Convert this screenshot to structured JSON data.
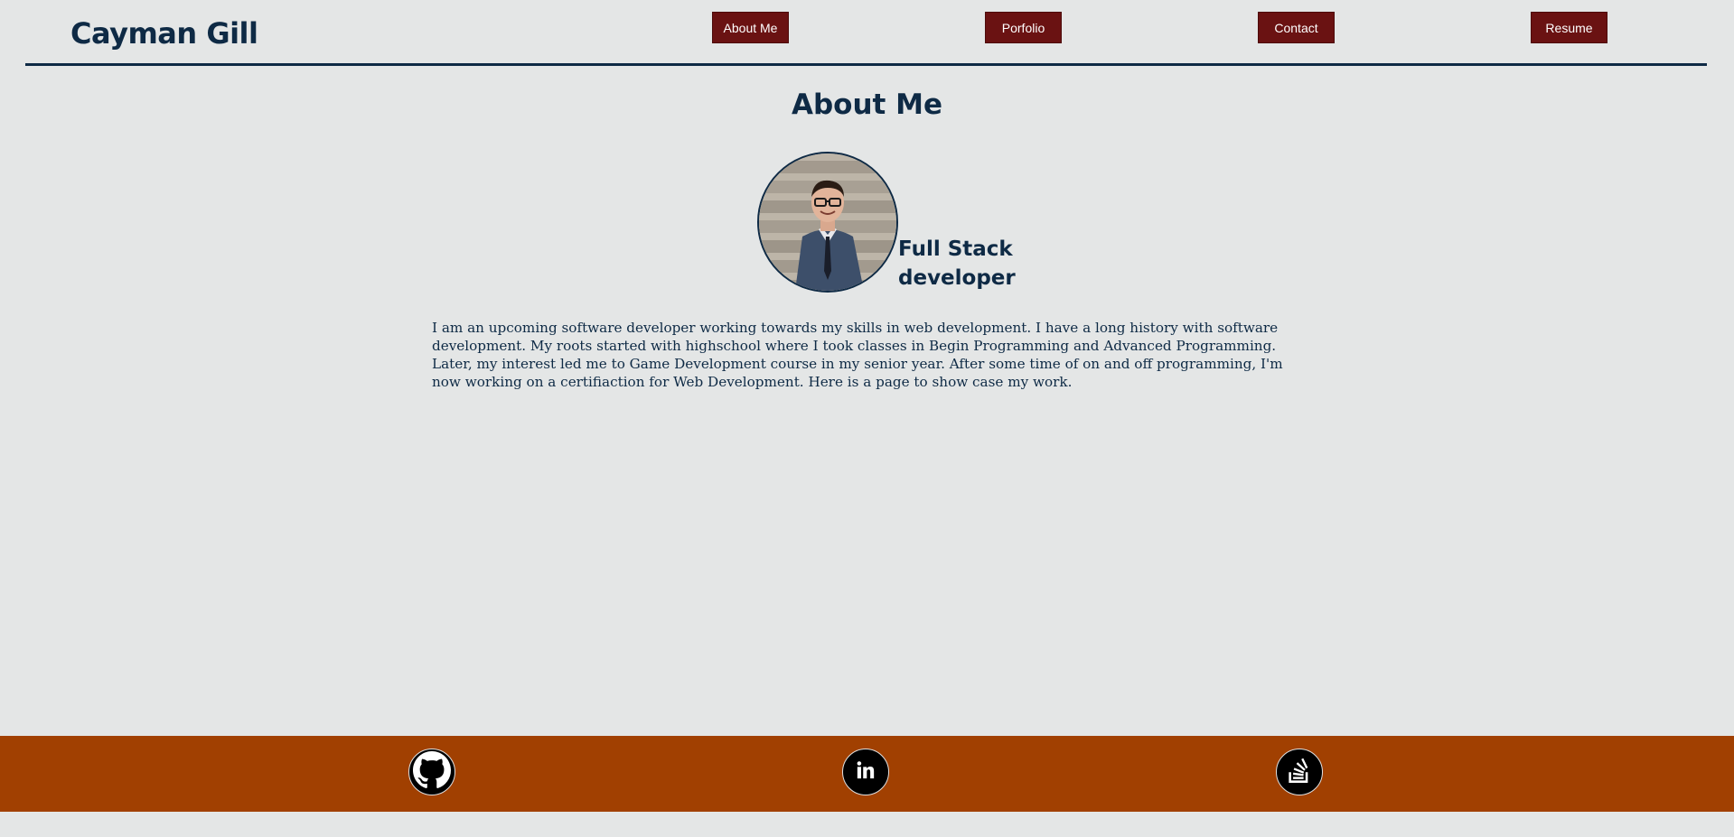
{
  "header": {
    "site_title": "Cayman Gill",
    "nav": {
      "about": "About Me",
      "portfolio": "Porfolio",
      "contact": "Contact",
      "resume": "Resume"
    }
  },
  "main": {
    "section_title": "About Me",
    "role_line1": "Full Stack",
    "role_line2": "developer",
    "bio": "I am an upcoming software developer working towards my skills in web development. I have a long history with software development. My roots started with highschool where I took classes in Begin Programming and Advanced Programming. Later, my interest led me to Game Development course in my senior year. After some time of on and off programming, I'm now working on a certifiaction for Web Development. Here is a page to show case my work."
  },
  "footer": {
    "social_icons": [
      "github-icon",
      "linkedin-icon",
      "stackoverflow-icon"
    ]
  },
  "colors": {
    "background": "#e4e6e6",
    "primary_text": "#0e2a45",
    "nav_button": "#6a1212",
    "footer": "#a14001"
  }
}
